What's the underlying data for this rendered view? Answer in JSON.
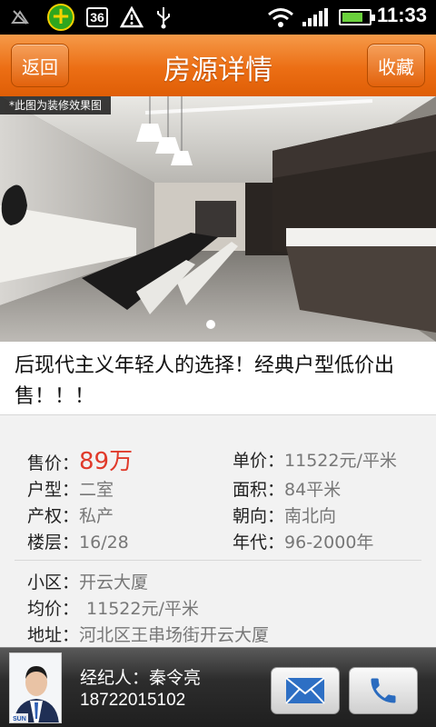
{
  "status_bar": {
    "time": "11:33",
    "network_badge": "36",
    "icons": [
      "antenna-off-icon",
      "qq-plus-icon",
      "3g-badge-icon",
      "warning-icon",
      "usb-icon",
      "wifi-icon",
      "signal-icon",
      "battery-charging-icon"
    ]
  },
  "header": {
    "back_label": "返回",
    "title": "房源详情",
    "favorite_label": "收藏"
  },
  "photo": {
    "caption": "*此图为装修效果图",
    "page_indicator": {
      "current": 1,
      "total": 1
    }
  },
  "listing": {
    "title": "后现代主义年轻人的选择！经典户型低价出售！！！"
  },
  "details": {
    "price_label": "售价：",
    "price_value": "89万",
    "unit_price_label": "单价：",
    "unit_price_value": "11522元/平米",
    "layout_label": "户型：",
    "layout_value": "二室",
    "area_label": "面积：",
    "area_value": "84平米",
    "ownership_label": "产权：",
    "ownership_value": "私产",
    "orientation_label": "朝向：",
    "orientation_value": "南北向",
    "floor_label": "楼层：",
    "floor_value": "16/28",
    "year_label": "年代：",
    "year_value": "96-2000年"
  },
  "community": {
    "name_label": "小区：",
    "name_value": "开云大厦",
    "avg_label": "均价：",
    "avg_value": "11522元/平米",
    "address_label": "地址：",
    "address_value": "河北区王串场街开云大厦"
  },
  "agent": {
    "label": "经纪人：",
    "name": "秦令亮",
    "phone": "18722015102",
    "logo_text": "SUN"
  },
  "colors": {
    "header_orange": "#ec6e14",
    "price_red": "#e03a2a",
    "bottom_bar": "#2d2d2d"
  }
}
